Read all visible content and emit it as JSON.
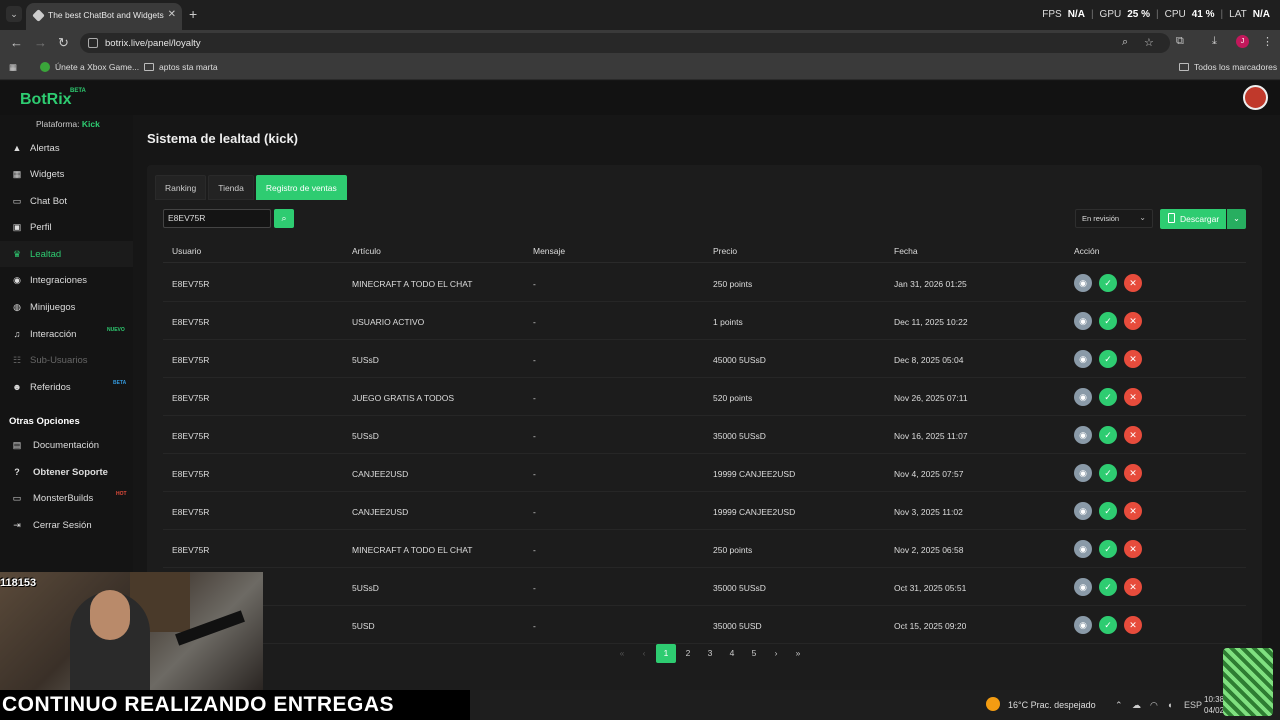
{
  "browser": {
    "tab_title": "The best ChatBot and Widgets",
    "url": "botrix.live/panel/loyalty",
    "perf": {
      "fps_label": "FPS",
      "fps": "N/A",
      "gpu_label": "GPU",
      "gpu": "25 %",
      "cpu_label": "CPU",
      "cpu": "41 %",
      "lat_label": "LAT",
      "lat": "N/A"
    },
    "bookmarks": [
      "Únete a Xbox Game...",
      "aptos sta marta"
    ],
    "all_bookmarks": "Todos los marcadores",
    "profile_initial": "J"
  },
  "app": {
    "logo": "BotRix",
    "logo_beta": "BETA",
    "platform_label": "Plataforma:",
    "platform_value": "Kick",
    "nav": [
      {
        "label": "Alertas",
        "icon": "warning-icon"
      },
      {
        "label": "Widgets",
        "icon": "widgets-icon"
      },
      {
        "label": "Chat Bot",
        "icon": "chat-icon"
      },
      {
        "label": "Perfil",
        "icon": "profile-icon"
      },
      {
        "label": "Lealtad",
        "icon": "trophy-icon"
      },
      {
        "label": "Integraciones",
        "icon": "integrations-icon"
      },
      {
        "label": "Minijuegos",
        "icon": "gamepad-icon"
      },
      {
        "label": "Interacción",
        "icon": "music-icon",
        "badge": "NUEVO"
      },
      {
        "label": "Sub-Usuarios",
        "icon": "users-icon"
      },
      {
        "label": "Referidos",
        "icon": "referrals-icon",
        "badge": "BETA"
      }
    ],
    "other_title": "Otras Opciones",
    "other": [
      {
        "label": "Documentación",
        "icon": "book-icon"
      },
      {
        "label": "Obtener Soporte",
        "icon": "help-icon"
      },
      {
        "label": "MonsterBuilds",
        "icon": "monitor-icon",
        "badge": "HOT"
      },
      {
        "label": "Cerrar Sesión",
        "icon": "logout-icon"
      }
    ],
    "page_title": "Sistema de lealtad (kick)",
    "tabs": [
      "Ranking",
      "Tienda",
      "Registro de ventas"
    ],
    "search_value": "E8EV75R",
    "filter_value": "En revisión",
    "download_label": "Descargar",
    "columns": [
      "Usuario",
      "Artículo",
      "Mensaje",
      "Precio",
      "Fecha",
      "Acción"
    ],
    "rows": [
      [
        "E8EV75R",
        "MINECRAFT A TODO EL CHAT",
        "-",
        "250 points",
        "Jan 31, 2026 01:25"
      ],
      [
        "E8EV75R",
        "USUARIO ACTIVO",
        "-",
        "1 points",
        "Dec 11, 2025 10:22"
      ],
      [
        "E8EV75R",
        "5USsD",
        "-",
        "45000 5USsD",
        "Dec 8, 2025 05:04"
      ],
      [
        "E8EV75R",
        "JUEGO GRATIS A TODOS",
        "-",
        "520 points",
        "Nov 26, 2025 07:11"
      ],
      [
        "E8EV75R",
        "5USsD",
        "-",
        "35000 5USsD",
        "Nov 16, 2025 11:07"
      ],
      [
        "E8EV75R",
        "CANJEE2USD",
        "-",
        "19999 CANJEE2USD",
        "Nov 4, 2025 07:57"
      ],
      [
        "E8EV75R",
        "CANJEE2USD",
        "-",
        "19999 CANJEE2USD",
        "Nov 3, 2025 11:02"
      ],
      [
        "E8EV75R",
        "MINECRAFT A TODO EL CHAT",
        "-",
        "250 points",
        "Nov 2, 2025 06:58"
      ],
      [
        "",
        "5USsD",
        "-",
        "35000 5USsD",
        "Oct 31, 2025 05:51"
      ],
      [
        "",
        "5USD",
        "-",
        "35000 5USD",
        "Oct 15, 2025 09:20"
      ]
    ],
    "pages": [
      "1",
      "2",
      "3",
      "4",
      "5"
    ],
    "current_page": "1"
  },
  "overlay": {
    "sub_count": "118153",
    "caption": "CONTINUO REALIZANDO ENTREGAS"
  },
  "taskbar": {
    "weather": "16°C  Prac. despejado",
    "lang": "ESP",
    "time": "10:38",
    "date": "04/02/"
  },
  "colors": {
    "accent": "#2ecc71",
    "danger": "#e74c3c",
    "view": "#8a9aa8"
  }
}
